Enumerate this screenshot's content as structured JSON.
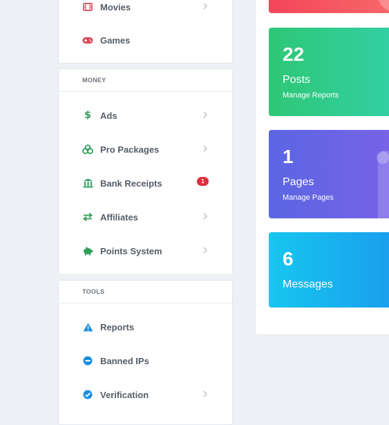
{
  "nav_top": {
    "items": [
      {
        "label": "Movies",
        "icon": "film-icon",
        "color": "#e05260"
      },
      {
        "label": "Games",
        "icon": "gamepad-icon",
        "color": "#e0404e"
      }
    ]
  },
  "money": {
    "title": "MONEY",
    "items": [
      {
        "label": "Ads",
        "icon": "dollar-icon",
        "color": "#2e9e5a"
      },
      {
        "label": "Pro Packages",
        "icon": "coins-icon",
        "color": "#2e9e5a"
      },
      {
        "label": "Bank Receipts",
        "icon": "bank-icon",
        "color": "#2e9e5a",
        "badge": "1"
      },
      {
        "label": "Affiliates",
        "icon": "exchange-icon",
        "color": "#2e9e5a"
      },
      {
        "label": "Points System",
        "icon": "piggy-bank-icon",
        "color": "#2e9e5a"
      }
    ]
  },
  "tools": {
    "title": "TOOLS",
    "items": [
      {
        "label": "Reports",
        "icon": "warning-icon",
        "color": "#1a8fe0"
      },
      {
        "label": "Banned IPs",
        "icon": "minus-circle-icon",
        "color": "#1a8fe0"
      },
      {
        "label": "Verification",
        "icon": "check-circle-icon",
        "color": "#1a8fe0"
      }
    ]
  },
  "cards": {
    "posts": {
      "value": "22",
      "title": "Posts",
      "subtitle": "Manage Reports"
    },
    "pages": {
      "value": "1",
      "title": "Pages",
      "subtitle": "Manage Pages"
    },
    "messages": {
      "value": "6",
      "title": "Messages"
    }
  }
}
